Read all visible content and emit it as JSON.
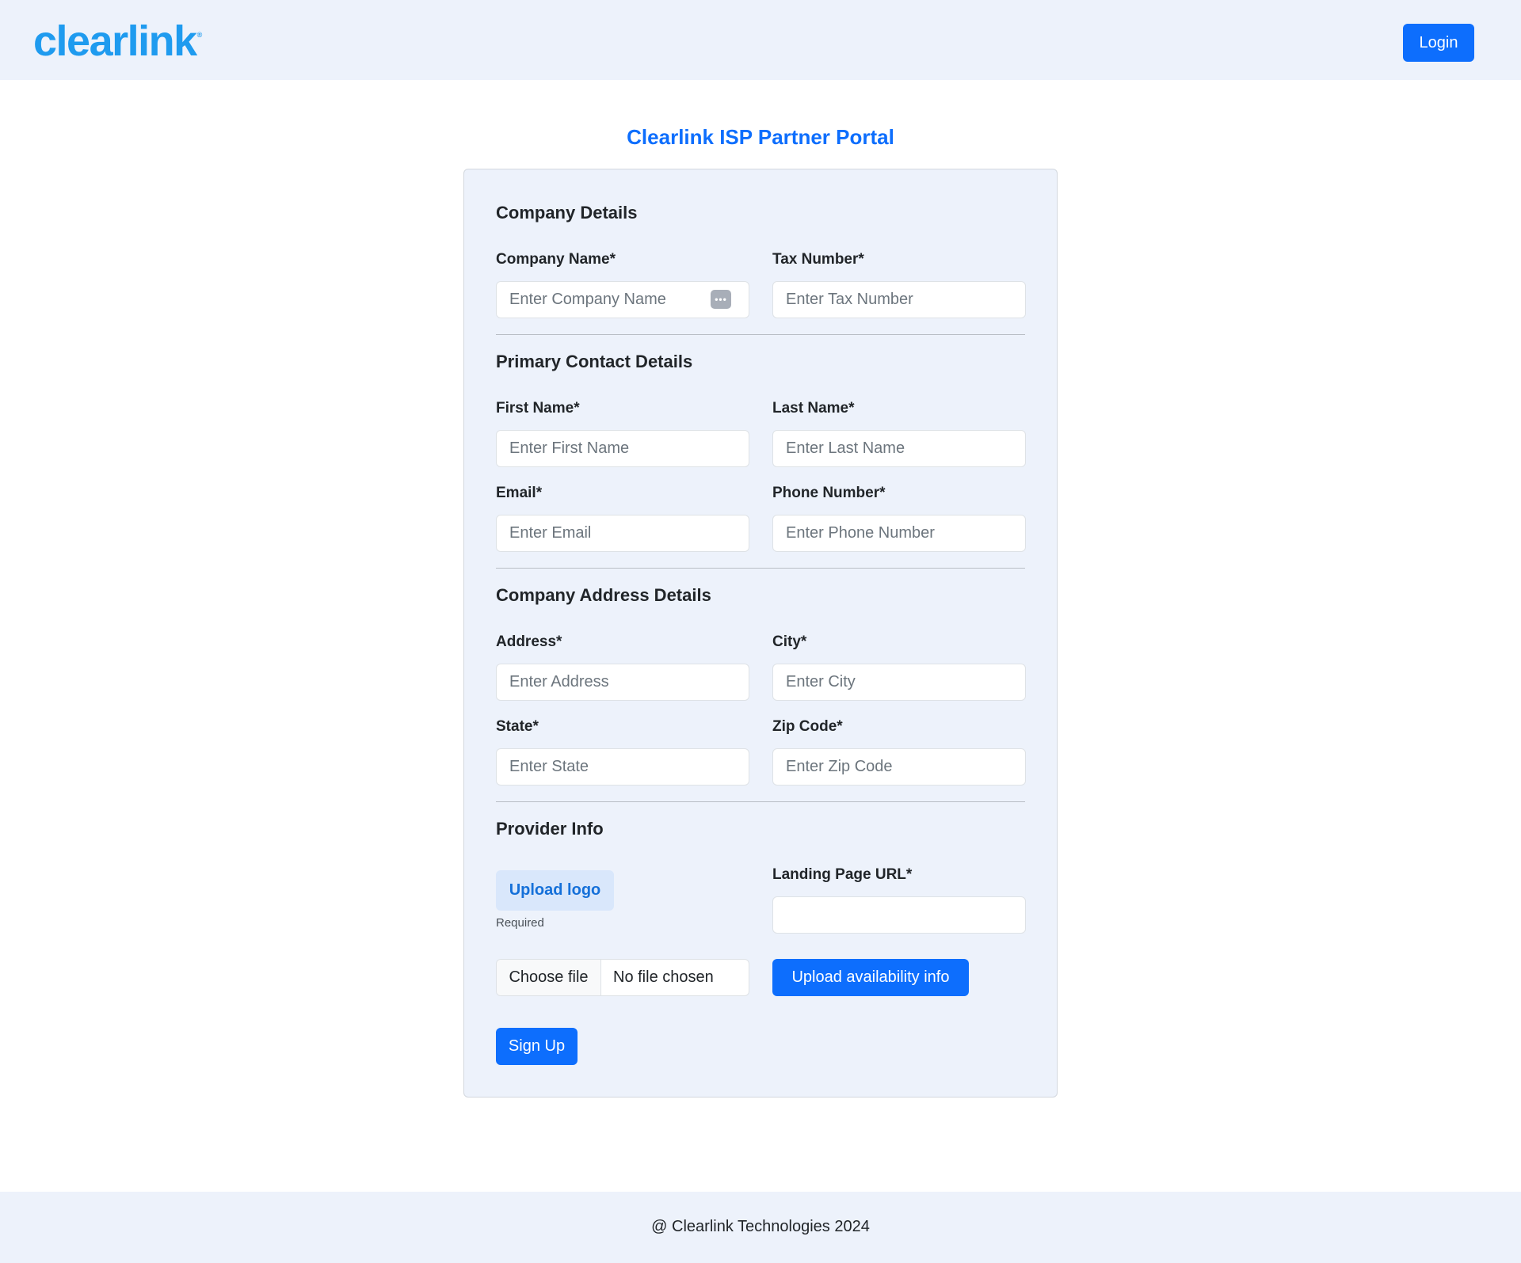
{
  "header": {
    "logo_text": "clearlink",
    "logo_mark": "®",
    "login_label": "Login"
  },
  "portal_title": "Clearlink ISP Partner Portal",
  "colors": {
    "primary": "#0d6efd",
    "brand": "#1f9bef",
    "background_tint": "#edf2fb"
  },
  "form": {
    "company": {
      "title": "Company Details",
      "company_name_label": "Company Name*",
      "company_name_placeholder": "Enter Company Name",
      "company_name_icon": "password-manager-icon",
      "tax_number_label": "Tax Number*",
      "tax_number_placeholder": "Enter Tax Number"
    },
    "contact": {
      "title": "Primary Contact Details",
      "first_name_label": "First Name*",
      "first_name_placeholder": "Enter First Name",
      "last_name_label": "Last Name*",
      "last_name_placeholder": "Enter Last Name",
      "email_label": "Email*",
      "email_placeholder": "Enter Email",
      "phone_label": "Phone Number*",
      "phone_placeholder": "Enter Phone Number"
    },
    "address": {
      "title": "Company Address Details",
      "address_label": "Address*",
      "address_placeholder": "Enter Address",
      "city_label": "City*",
      "city_placeholder": "Enter City",
      "state_label": "State*",
      "state_placeholder": "Enter State",
      "zip_label": "Zip Code*",
      "zip_placeholder": "Enter Zip Code"
    },
    "provider": {
      "title": "Provider Info",
      "upload_logo_label": "Upload logo",
      "upload_logo_note": "Required",
      "landing_url_label": "Landing Page URL*",
      "landing_url_value": "",
      "choose_file_label": "Choose file",
      "file_status": "No file chosen",
      "upload_availability_label": "Upload availability info"
    },
    "signup_label": "Sign Up"
  },
  "footer": {
    "text": "@ Clearlink Technologies 2024"
  }
}
